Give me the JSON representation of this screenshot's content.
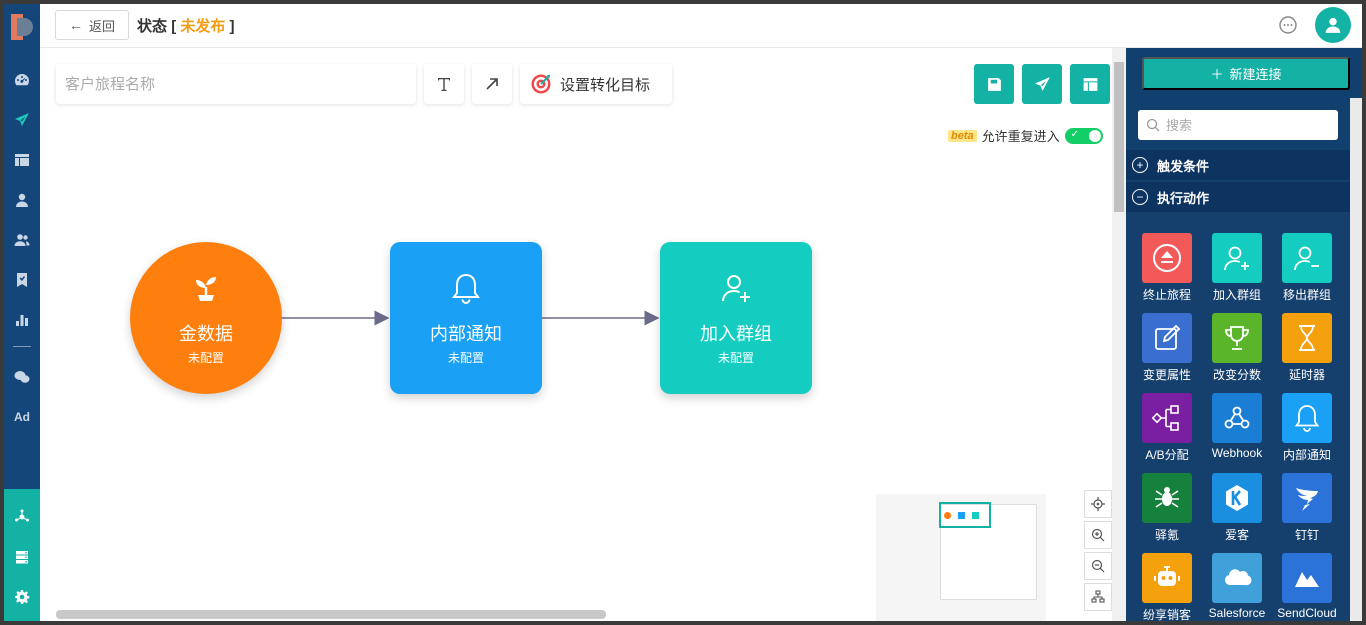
{
  "header": {
    "back_label": "返回",
    "status_label": "状态",
    "bracket_open": "[",
    "status_value": "未发布",
    "bracket_close": "]"
  },
  "toolbar": {
    "name_placeholder": "客户旅程名称",
    "goal_label": "设置转化目标"
  },
  "reentry": {
    "beta": "beta",
    "label": "允许重复进入",
    "enabled": true
  },
  "nav": {
    "ad_label": "Ad"
  },
  "flow": {
    "nodes": [
      {
        "title": "金数据",
        "subtitle": "未配置",
        "color": "#ff7f0e",
        "icon": "sprout-icon"
      },
      {
        "title": "内部通知",
        "subtitle": "未配置",
        "color": "#1aa1f5",
        "icon": "bell-icon"
      },
      {
        "title": "加入群组",
        "subtitle": "未配置",
        "color": "#14ccc0",
        "icon": "user-add-icon"
      }
    ]
  },
  "panel": {
    "new_connection": "新建连接",
    "search_placeholder": "搜索",
    "sections": [
      {
        "label": "触发条件",
        "expanded": false
      },
      {
        "label": "执行动作",
        "expanded": true
      }
    ],
    "actions": [
      {
        "label": "终止旅程",
        "color": "#f25a5a",
        "icon": "eject-icon"
      },
      {
        "label": "加入群组",
        "color": "#14ccc0",
        "icon": "user-add-icon"
      },
      {
        "label": "移出群组",
        "color": "#14ccc0",
        "icon": "user-remove-icon"
      },
      {
        "label": "变更属性",
        "color": "#3a6fd0",
        "icon": "edit-icon"
      },
      {
        "label": "改变分数",
        "color": "#5ab52b",
        "icon": "trophy-icon"
      },
      {
        "label": "延时器",
        "color": "#f5a00d",
        "icon": "hourglass-icon"
      },
      {
        "label": "A/B分配",
        "color": "#7a1fa2",
        "icon": "split-icon"
      },
      {
        "label": "Webhook",
        "color": "#1a7fd4",
        "icon": "webhook-icon"
      },
      {
        "label": "内部通知",
        "color": "#1aa1f5",
        "icon": "bell-icon"
      },
      {
        "label": "驿氪",
        "color": "#16813c",
        "icon": "spider-icon"
      },
      {
        "label": "爱客",
        "color": "#1a8fe0",
        "icon": "k-logo-icon"
      },
      {
        "label": "钉钉",
        "color": "#2b73d8",
        "icon": "dingtalk-icon"
      },
      {
        "label": "纷享销客",
        "color": "#f5a00d",
        "icon": "robot-icon"
      },
      {
        "label": "Salesforce",
        "color": "#3fa0da",
        "icon": "cloud-icon"
      },
      {
        "label": "SendCloud",
        "color": "#2b73d8",
        "icon": "sendcloud-icon"
      }
    ]
  }
}
